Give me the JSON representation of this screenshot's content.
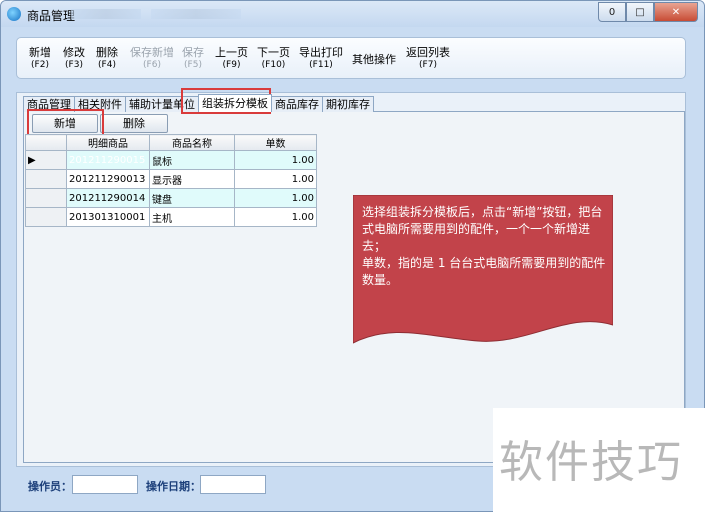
{
  "window": {
    "title": "商品管理",
    "min_label": "0",
    "max_label": "□",
    "close_label": "✕"
  },
  "toolbar": {
    "items": [
      {
        "label": "新增",
        "key": "(F2)"
      },
      {
        "label": "修改",
        "key": "(F3)"
      },
      {
        "label": "删除",
        "key": "(F4)"
      },
      {
        "label": "保存新增",
        "key": "(F6)"
      },
      {
        "label": "保存",
        "key": "(F5)"
      },
      {
        "label": "上一页",
        "key": "(F9)"
      },
      {
        "label": "下一页",
        "key": "(F10)"
      },
      {
        "label": "导出打印",
        "key": "(F11)"
      },
      {
        "label": "其他操作",
        "key": ""
      },
      {
        "label": "返回列表",
        "key": "(F7)"
      }
    ]
  },
  "tabs": [
    "商品管理",
    "相关附件",
    "辅助计量单位",
    "组装拆分模板",
    "商品库存",
    "期初库存"
  ],
  "subtoolbar": {
    "add_label": "新增",
    "delete_label": "删除"
  },
  "grid": {
    "headers": [
      "明细商品",
      "商品名称",
      "单数"
    ],
    "current_row_marker": "▶",
    "rows": [
      {
        "code": "201211290015",
        "name": "鼠标",
        "qty": "1.00"
      },
      {
        "code": "201211290013",
        "name": "显示器",
        "qty": "1.00"
      },
      {
        "code": "201211290014",
        "name": "键盘",
        "qty": "1.00"
      },
      {
        "code": "201301310001",
        "name": "主机",
        "qty": "1.00"
      }
    ]
  },
  "note": {
    "line1": "选择组装拆分模板后，点击“新增”按钮，把台式电脑所需要用到的配件，一个一个新增进去；",
    "line2": "单数，指的是 1 台台式电脑所需要用到的配件数量。"
  },
  "footer": {
    "operator_label": "操作员：",
    "date_label": "操作日期："
  },
  "watermark": {
    "text": "软件技巧"
  },
  "colors": {
    "note_fill": "#c2434a",
    "highlight_border": "#d93b3b",
    "selected_cell": "#3c82d8"
  }
}
